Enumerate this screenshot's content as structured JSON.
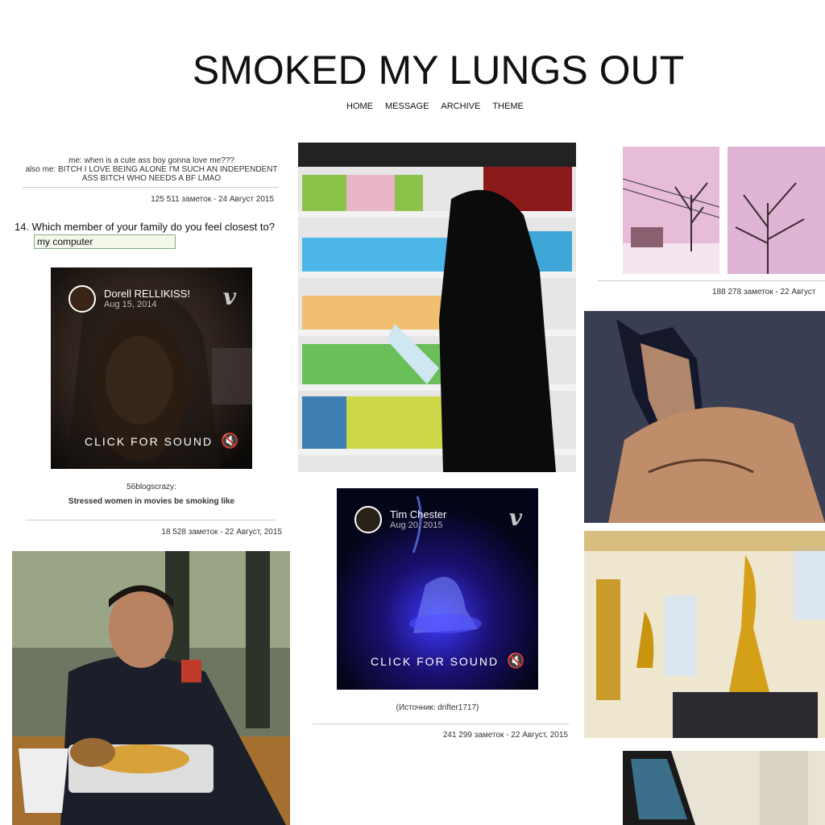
{
  "header": {
    "title": "SMOKED MY LUNGS OUT",
    "nav": [
      "HOME",
      "MESSAGE",
      "ARCHIVE",
      "THEME"
    ]
  },
  "posts": {
    "text_post": {
      "line1": "me: when is a cute ass boy gonna love me???",
      "line2": "also me: BITCH I LOVE BEING ALONE I'M SUCH AN INDEPENDENT",
      "line3": "ASS BITCH WHO NEEDS A BF LMAO",
      "meta": "125 511 заметок   -   24 Август 2015"
    },
    "quiz": {
      "question": "14. Which member of your family do you feel closest to?",
      "answer": "my computer"
    },
    "vine1": {
      "name": "Dorell RELLIKISS!",
      "date": "Aug 15, 2014",
      "sound_label": "CLICK FOR SOUND",
      "source_user": "56blogscrazy:",
      "caption": "Stressed women in movies be smoking like",
      "meta": "18 528 заметок   -   22 Август, 2015"
    },
    "vine2": {
      "name": "Tim Chester",
      "date": "Aug 20, 2015",
      "sound_label": "CLICK FOR SOUND",
      "source": "(Источник: drifter1717)",
      "meta": "241 299 заметок   -   22 Август, 2015"
    },
    "sky_photoset": {
      "meta": "188 278 заметок   -   22 Август"
    }
  },
  "icons": {
    "vine": "vine-logo-icon",
    "mute": "speaker-mute-icon"
  },
  "colors": {
    "background": "#ffffff",
    "text": "#111111",
    "rule": "#cccccc"
  }
}
